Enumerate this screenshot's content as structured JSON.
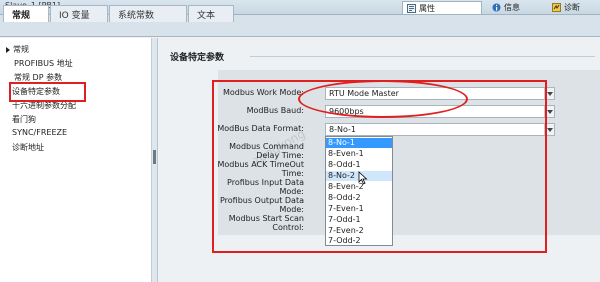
{
  "window": {
    "title": "Slave_1 [PB1]"
  },
  "right_tabs": [
    {
      "label": "属性",
      "icon": "properties-icon"
    },
    {
      "label": "信息",
      "icon": "info-icon"
    },
    {
      "label": "诊断",
      "icon": "diagnostics-icon"
    }
  ],
  "main_tabs": [
    "常规",
    "IO 变量",
    "系统常数",
    "文本"
  ],
  "nav": {
    "items": [
      "常规",
      "PROFIBUS 地址",
      "常规 DP 参数",
      "设备特定参数",
      "十六进制参数分配",
      "看门狗",
      "SYNC/FREEZE",
      "诊断地址"
    ],
    "selected": "设备特定参数"
  },
  "section": {
    "title": "设备特定参数"
  },
  "params": {
    "labels": [
      "Modbus Work Mode:",
      "ModBus Baud:",
      "ModBus Data Format:",
      "Modbus Command Delay Time:",
      "Modbus ACK TimeOut Time:",
      "Profibus Input Data Mode:",
      "Profibus Output Data Mode:",
      "Modbus Start Scan Control:"
    ],
    "work_mode": "RTU Mode Master",
    "baud": "9600bps",
    "data_format": "8-No-1"
  },
  "dropdown": {
    "options": [
      "8-No-1",
      "8-Even-1",
      "8-Odd-1",
      "8-No-2",
      "8-Even-2",
      "8-Odd-2",
      "7-Even-1",
      "7-Odd-1",
      "7-Even-2",
      "7-Odd-2"
    ],
    "selected": "8-No-1",
    "hovered": "8-No-2"
  },
  "watermark": "zongkong",
  "colors": {
    "annotation": "#e02020",
    "selection": "#3399ff",
    "hover": "#cfe6fb"
  }
}
